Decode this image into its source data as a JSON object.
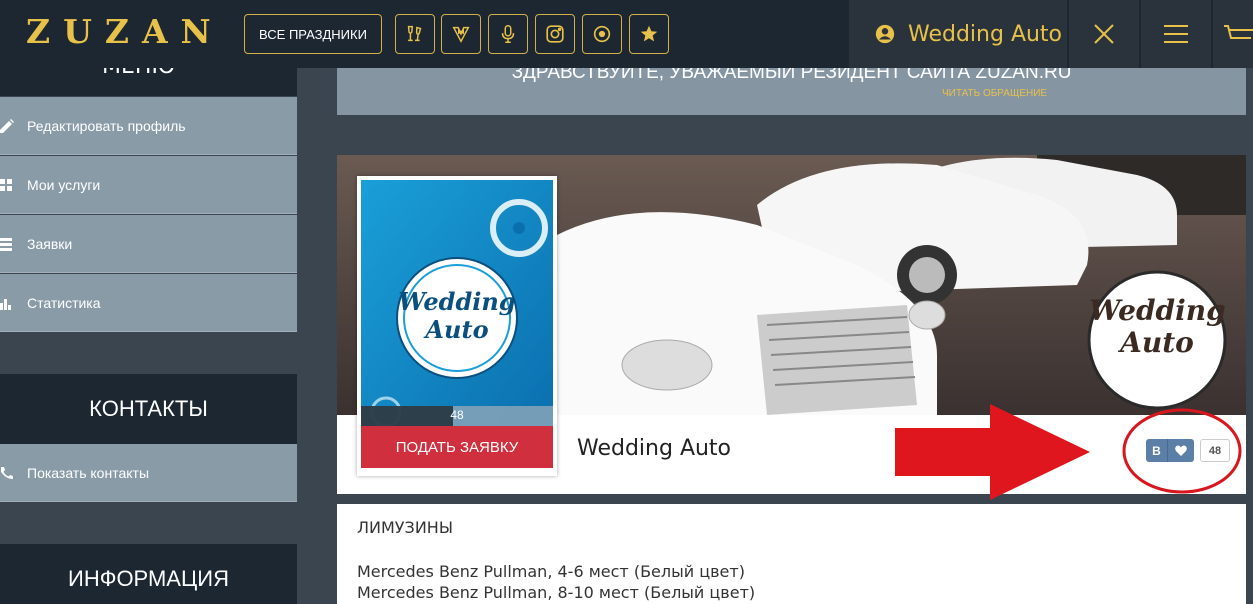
{
  "header": {
    "logo": "ZUZAN",
    "holidays_label": "ВСЕ ПРАЗДНИКИ",
    "categories": [
      {
        "icon": "champagne-glasses-icon"
      },
      {
        "icon": "tuxedo-icon"
      },
      {
        "icon": "microphone-icon"
      },
      {
        "icon": "camera-icon"
      },
      {
        "icon": "vinyl-record-icon"
      },
      {
        "icon": "star-icon"
      }
    ],
    "user_name": "Wedding Auto",
    "accent_color": "#e8c14a"
  },
  "sidebar": {
    "menu_title": "МЕНЮ",
    "items": [
      {
        "label": "Редактировать профиль",
        "icon": "pencil-icon"
      },
      {
        "label": "Мои услуги",
        "icon": "grid-icon"
      },
      {
        "label": "Заявки",
        "icon": "list-icon"
      },
      {
        "label": "Статистика",
        "icon": "bar-chart-icon"
      }
    ],
    "contacts_title": "КОНТАКТЫ",
    "contacts_item": {
      "label": "Показать контакты",
      "icon": "phone-icon"
    },
    "info_title": "ИНФОРМАЦИЯ"
  },
  "banner": {
    "greeting": "ЗДРАВСТВУЙТЕ, УВАЖАЕМЫЙ РЕЗИДЕНТ САЙТА ZUZAN.RU",
    "link": "ЧИТАТЬ ОБРАЩЕНИЕ"
  },
  "profile": {
    "name": "Wedding Auto",
    "logo_line1": "Wedding",
    "logo_line2": "Auto",
    "photo_count": "48",
    "apply_label": "ПОДАТЬ ЗАЯВКУ",
    "vk_label": "В",
    "like_count": "48"
  },
  "description": {
    "lines": [
      "ЛИМУЗИНЫ",
      "Mercedes Benz Pullman, 4-6 мест (Белый цвет)",
      "Mercedes Benz Pullman, 8-10 мест (Белый цвет)"
    ]
  }
}
